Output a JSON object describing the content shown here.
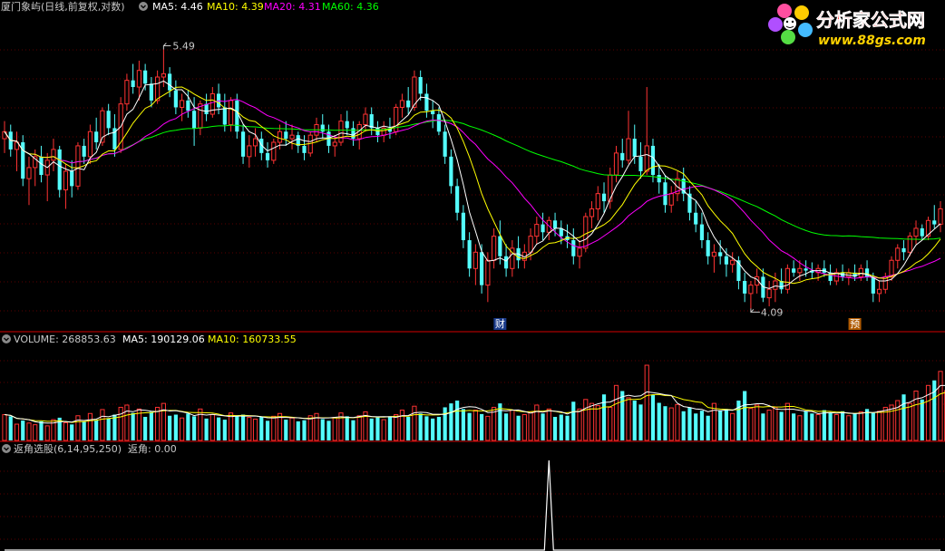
{
  "colors": {
    "background": "#000000",
    "divider": "#aa0000",
    "grid": "#5a0000",
    "up": "#ff3333",
    "down": "#54fcfc",
    "ma5": "#ffffff",
    "ma10": "#ffff00",
    "ma20": "#ff00ff",
    "ma60": "#00ff00",
    "text_gray": "#c8c8c8",
    "brand_red": "#ff2a2a",
    "brand_yellow": "#ffd200"
  },
  "main_panel": {
    "title": "厦门象屿(日线,前复权,对数)",
    "ma5_label": "MA5: 4.46",
    "ma10_label": "MA10: 4.39",
    "ma20_label": "MA20: 4.31",
    "ma60_label": "MA60: 4.36",
    "high_marker": "5.49",
    "low_marker": "4.09",
    "badge_1": "财",
    "badge_2": "预"
  },
  "volume_panel": {
    "volume_label": "VOLUME: 268853.63",
    "ma5_label": "MA5: 190129.06",
    "ma10_label": "MA10: 160733.55"
  },
  "indicator_panel": {
    "title": "返角选股(6,14,95,250)",
    "value_label": "返角: 0.00"
  },
  "logo": {
    "name": "分析家公式网",
    "url_text": "www.88gs.com",
    "icon": "flower-logo-icon"
  },
  "chart_data": {
    "type": "candlestick",
    "scale": "log",
    "price_range": [
      4.0,
      5.7
    ],
    "volume_range": [
      0,
      310000
    ],
    "indicator_range": [
      0,
      1
    ],
    "annotated_high": 5.49,
    "annotated_low": 4.09,
    "candles": [
      {
        "o": 4.96,
        "h": 5.06,
        "l": 4.88,
        "c": 5.0
      },
      {
        "o": 5.0,
        "h": 5.04,
        "l": 4.86,
        "c": 4.9
      },
      {
        "o": 4.9,
        "h": 5.0,
        "l": 4.78,
        "c": 4.94
      },
      {
        "o": 4.94,
        "h": 4.98,
        "l": 4.7,
        "c": 4.74
      },
      {
        "o": 4.74,
        "h": 4.86,
        "l": 4.6,
        "c": 4.8
      },
      {
        "o": 4.8,
        "h": 4.9,
        "l": 4.7,
        "c": 4.86
      },
      {
        "o": 4.86,
        "h": 4.92,
        "l": 4.72,
        "c": 4.76
      },
      {
        "o": 4.76,
        "h": 4.88,
        "l": 4.62,
        "c": 4.84
      },
      {
        "o": 4.84,
        "h": 4.96,
        "l": 4.78,
        "c": 4.9
      },
      {
        "o": 4.9,
        "h": 4.92,
        "l": 4.64,
        "c": 4.68
      },
      {
        "o": 4.68,
        "h": 4.82,
        "l": 4.58,
        "c": 4.78
      },
      {
        "o": 4.78,
        "h": 4.84,
        "l": 4.64,
        "c": 4.7
      },
      {
        "o": 4.7,
        "h": 4.94,
        "l": 4.68,
        "c": 4.92
      },
      {
        "o": 4.92,
        "h": 4.96,
        "l": 4.82,
        "c": 4.86
      },
      {
        "o": 4.86,
        "h": 5.04,
        "l": 4.82,
        "c": 5.0
      },
      {
        "o": 5.0,
        "h": 5.08,
        "l": 4.9,
        "c": 4.94
      },
      {
        "o": 4.94,
        "h": 5.14,
        "l": 4.92,
        "c": 5.12
      },
      {
        "o": 5.12,
        "h": 5.16,
        "l": 4.98,
        "c": 5.02
      },
      {
        "o": 5.02,
        "h": 5.1,
        "l": 4.86,
        "c": 4.9
      },
      {
        "o": 4.9,
        "h": 5.2,
        "l": 4.88,
        "c": 5.16
      },
      {
        "o": 5.16,
        "h": 5.34,
        "l": 5.12,
        "c": 5.3
      },
      {
        "o": 5.3,
        "h": 5.4,
        "l": 5.22,
        "c": 5.26
      },
      {
        "o": 5.26,
        "h": 5.42,
        "l": 5.18,
        "c": 5.36
      },
      {
        "o": 5.36,
        "h": 5.4,
        "l": 5.24,
        "c": 5.28
      },
      {
        "o": 5.28,
        "h": 5.32,
        "l": 5.14,
        "c": 5.18
      },
      {
        "o": 5.18,
        "h": 5.36,
        "l": 5.16,
        "c": 5.32
      },
      {
        "o": 5.32,
        "h": 5.49,
        "l": 5.26,
        "c": 5.34
      },
      {
        "o": 5.34,
        "h": 5.38,
        "l": 5.2,
        "c": 5.24
      },
      {
        "o": 5.24,
        "h": 5.3,
        "l": 5.1,
        "c": 5.14
      },
      {
        "o": 5.14,
        "h": 5.22,
        "l": 5.06,
        "c": 5.18
      },
      {
        "o": 5.18,
        "h": 5.24,
        "l": 5.08,
        "c": 5.12
      },
      {
        "o": 5.12,
        "h": 5.2,
        "l": 4.92,
        "c": 5.02
      },
      {
        "o": 5.02,
        "h": 5.18,
        "l": 4.98,
        "c": 5.16
      },
      {
        "o": 5.16,
        "h": 5.22,
        "l": 5.06,
        "c": 5.1
      },
      {
        "o": 5.1,
        "h": 5.26,
        "l": 5.08,
        "c": 5.22
      },
      {
        "o": 5.22,
        "h": 5.28,
        "l": 5.1,
        "c": 5.14
      },
      {
        "o": 5.14,
        "h": 5.22,
        "l": 5.0,
        "c": 5.04
      },
      {
        "o": 5.04,
        "h": 5.2,
        "l": 5.0,
        "c": 5.18
      },
      {
        "o": 5.18,
        "h": 5.22,
        "l": 4.96,
        "c": 5.0
      },
      {
        "o": 5.0,
        "h": 5.04,
        "l": 4.82,
        "c": 4.86
      },
      {
        "o": 4.86,
        "h": 4.98,
        "l": 4.8,
        "c": 4.92
      },
      {
        "o": 4.92,
        "h": 5.02,
        "l": 4.86,
        "c": 4.96
      },
      {
        "o": 4.96,
        "h": 5.0,
        "l": 4.84,
        "c": 4.88
      },
      {
        "o": 4.88,
        "h": 4.94,
        "l": 4.8,
        "c": 4.84
      },
      {
        "o": 4.84,
        "h": 4.96,
        "l": 4.82,
        "c": 4.94
      },
      {
        "o": 4.94,
        "h": 5.04,
        "l": 4.9,
        "c": 5.0
      },
      {
        "o": 5.0,
        "h": 5.06,
        "l": 4.92,
        "c": 4.96
      },
      {
        "o": 4.96,
        "h": 5.04,
        "l": 4.9,
        "c": 4.98
      },
      {
        "o": 4.98,
        "h": 5.0,
        "l": 4.88,
        "c": 4.92
      },
      {
        "o": 4.92,
        "h": 4.98,
        "l": 4.84,
        "c": 4.88
      },
      {
        "o": 4.88,
        "h": 5.0,
        "l": 4.86,
        "c": 4.98
      },
      {
        "o": 4.98,
        "h": 5.08,
        "l": 4.94,
        "c": 5.04
      },
      {
        "o": 5.04,
        "h": 5.1,
        "l": 4.96,
        "c": 5.0
      },
      {
        "o": 5.0,
        "h": 5.04,
        "l": 4.88,
        "c": 4.92
      },
      {
        "o": 4.92,
        "h": 4.98,
        "l": 4.86,
        "c": 4.94
      },
      {
        "o": 4.94,
        "h": 5.1,
        "l": 4.92,
        "c": 5.06
      },
      {
        "o": 5.06,
        "h": 5.12,
        "l": 4.98,
        "c": 5.02
      },
      {
        "o": 5.02,
        "h": 5.06,
        "l": 4.92,
        "c": 4.96
      },
      {
        "o": 4.96,
        "h": 5.06,
        "l": 4.9,
        "c": 5.04
      },
      {
        "o": 5.04,
        "h": 5.14,
        "l": 5.0,
        "c": 5.1
      },
      {
        "o": 5.1,
        "h": 5.14,
        "l": 4.98,
        "c": 5.02
      },
      {
        "o": 5.02,
        "h": 5.06,
        "l": 4.94,
        "c": 4.98
      },
      {
        "o": 4.98,
        "h": 5.06,
        "l": 4.94,
        "c": 5.02
      },
      {
        "o": 5.02,
        "h": 5.08,
        "l": 4.96,
        "c": 5.0
      },
      {
        "o": 5.0,
        "h": 5.16,
        "l": 4.98,
        "c": 5.14
      },
      {
        "o": 5.14,
        "h": 5.22,
        "l": 5.08,
        "c": 5.18
      },
      {
        "o": 5.18,
        "h": 5.26,
        "l": 5.1,
        "c": 5.14
      },
      {
        "o": 5.14,
        "h": 5.36,
        "l": 5.12,
        "c": 5.32
      },
      {
        "o": 5.32,
        "h": 5.36,
        "l": 5.18,
        "c": 5.22
      },
      {
        "o": 5.22,
        "h": 5.28,
        "l": 5.08,
        "c": 5.12
      },
      {
        "o": 5.12,
        "h": 5.18,
        "l": 5.02,
        "c": 5.1
      },
      {
        "o": 5.1,
        "h": 5.14,
        "l": 4.98,
        "c": 5.0
      },
      {
        "o": 5.0,
        "h": 5.04,
        "l": 4.82,
        "c": 4.86
      },
      {
        "o": 4.86,
        "h": 4.9,
        "l": 4.66,
        "c": 4.7
      },
      {
        "o": 4.7,
        "h": 4.74,
        "l": 4.52,
        "c": 4.56
      },
      {
        "o": 4.56,
        "h": 4.6,
        "l": 4.38,
        "c": 4.42
      },
      {
        "o": 4.42,
        "h": 4.46,
        "l": 4.24,
        "c": 4.28
      },
      {
        "o": 4.28,
        "h": 4.4,
        "l": 4.2,
        "c": 4.36
      },
      {
        "o": 4.36,
        "h": 4.4,
        "l": 4.16,
        "c": 4.2
      },
      {
        "o": 4.2,
        "h": 4.36,
        "l": 4.12,
        "c": 4.32
      },
      {
        "o": 4.32,
        "h": 4.48,
        "l": 4.28,
        "c": 4.44
      },
      {
        "o": 4.44,
        "h": 4.52,
        "l": 4.3,
        "c": 4.34
      },
      {
        "o": 4.34,
        "h": 4.4,
        "l": 4.24,
        "c": 4.28
      },
      {
        "o": 4.28,
        "h": 4.42,
        "l": 4.24,
        "c": 4.38
      },
      {
        "o": 4.38,
        "h": 4.44,
        "l": 4.28,
        "c": 4.32
      },
      {
        "o": 4.32,
        "h": 4.4,
        "l": 4.28,
        "c": 4.36
      },
      {
        "o": 4.36,
        "h": 4.48,
        "l": 4.32,
        "c": 4.44
      },
      {
        "o": 4.44,
        "h": 4.54,
        "l": 4.4,
        "c": 4.5
      },
      {
        "o": 4.5,
        "h": 4.56,
        "l": 4.42,
        "c": 4.46
      },
      {
        "o": 4.46,
        "h": 4.54,
        "l": 4.42,
        "c": 4.52
      },
      {
        "o": 4.52,
        "h": 4.56,
        "l": 4.44,
        "c": 4.48
      },
      {
        "o": 4.48,
        "h": 4.52,
        "l": 4.4,
        "c": 4.44
      },
      {
        "o": 4.44,
        "h": 4.5,
        "l": 4.38,
        "c": 4.42
      },
      {
        "o": 4.42,
        "h": 4.48,
        "l": 4.3,
        "c": 4.34
      },
      {
        "o": 4.34,
        "h": 4.42,
        "l": 4.28,
        "c": 4.38
      },
      {
        "o": 4.38,
        "h": 4.56,
        "l": 4.36,
        "c": 4.54
      },
      {
        "o": 4.54,
        "h": 4.62,
        "l": 4.48,
        "c": 4.58
      },
      {
        "o": 4.58,
        "h": 4.7,
        "l": 4.52,
        "c": 4.66
      },
      {
        "o": 4.66,
        "h": 4.72,
        "l": 4.56,
        "c": 4.62
      },
      {
        "o": 4.62,
        "h": 4.8,
        "l": 4.58,
        "c": 4.76
      },
      {
        "o": 4.76,
        "h": 4.92,
        "l": 4.72,
        "c": 4.88
      },
      {
        "o": 4.88,
        "h": 4.96,
        "l": 4.8,
        "c": 4.84
      },
      {
        "o": 4.84,
        "h": 5.12,
        "l": 4.82,
        "c": 4.96
      },
      {
        "o": 4.96,
        "h": 5.04,
        "l": 4.82,
        "c": 4.86
      },
      {
        "o": 4.86,
        "h": 4.94,
        "l": 4.74,
        "c": 4.78
      },
      {
        "o": 4.78,
        "h": 5.26,
        "l": 4.76,
        "c": 4.92
      },
      {
        "o": 4.92,
        "h": 4.96,
        "l": 4.72,
        "c": 4.76
      },
      {
        "o": 4.76,
        "h": 4.82,
        "l": 4.66,
        "c": 4.72
      },
      {
        "o": 4.72,
        "h": 4.76,
        "l": 4.56,
        "c": 4.6
      },
      {
        "o": 4.6,
        "h": 4.7,
        "l": 4.56,
        "c": 4.66
      },
      {
        "o": 4.66,
        "h": 4.78,
        "l": 4.62,
        "c": 4.74
      },
      {
        "o": 4.74,
        "h": 4.8,
        "l": 4.62,
        "c": 4.66
      },
      {
        "o": 4.66,
        "h": 4.7,
        "l": 4.52,
        "c": 4.56
      },
      {
        "o": 4.56,
        "h": 4.62,
        "l": 4.46,
        "c": 4.5
      },
      {
        "o": 4.5,
        "h": 4.56,
        "l": 4.38,
        "c": 4.42
      },
      {
        "o": 4.42,
        "h": 4.46,
        "l": 4.3,
        "c": 4.34
      },
      {
        "o": 4.34,
        "h": 4.4,
        "l": 4.26,
        "c": 4.36
      },
      {
        "o": 4.36,
        "h": 4.42,
        "l": 4.3,
        "c": 4.34
      },
      {
        "o": 4.34,
        "h": 4.38,
        "l": 4.24,
        "c": 4.3
      },
      {
        "o": 4.3,
        "h": 4.36,
        "l": 4.26,
        "c": 4.32
      },
      {
        "o": 4.32,
        "h": 4.34,
        "l": 4.18,
        "c": 4.22
      },
      {
        "o": 4.22,
        "h": 4.26,
        "l": 4.12,
        "c": 4.16
      },
      {
        "o": 4.16,
        "h": 4.22,
        "l": 4.09,
        "c": 4.2
      },
      {
        "o": 4.2,
        "h": 4.28,
        "l": 4.16,
        "c": 4.24
      },
      {
        "o": 4.24,
        "h": 4.28,
        "l": 4.12,
        "c": 4.14
      },
      {
        "o": 4.14,
        "h": 4.22,
        "l": 4.1,
        "c": 4.18
      },
      {
        "o": 4.18,
        "h": 4.26,
        "l": 4.12,
        "c": 4.22
      },
      {
        "o": 4.22,
        "h": 4.28,
        "l": 4.16,
        "c": 4.18
      },
      {
        "o": 4.18,
        "h": 4.3,
        "l": 4.16,
        "c": 4.28
      },
      {
        "o": 4.28,
        "h": 4.32,
        "l": 4.24,
        "c": 4.26
      },
      {
        "o": 4.26,
        "h": 4.32,
        "l": 4.22,
        "c": 4.28
      },
      {
        "o": 4.28,
        "h": 4.32,
        "l": 4.24,
        "c": 4.27
      },
      {
        "o": 4.27,
        "h": 4.31,
        "l": 4.23,
        "c": 4.26
      },
      {
        "o": 4.26,
        "h": 4.3,
        "l": 4.22,
        "c": 4.28
      },
      {
        "o": 4.28,
        "h": 4.32,
        "l": 4.24,
        "c": 4.26
      },
      {
        "o": 4.26,
        "h": 4.3,
        "l": 4.2,
        "c": 4.22
      },
      {
        "o": 4.22,
        "h": 4.28,
        "l": 4.2,
        "c": 4.26
      },
      {
        "o": 4.26,
        "h": 4.3,
        "l": 4.22,
        "c": 4.24
      },
      {
        "o": 4.24,
        "h": 4.28,
        "l": 4.2,
        "c": 4.26
      },
      {
        "o": 4.26,
        "h": 4.3,
        "l": 4.22,
        "c": 4.24
      },
      {
        "o": 4.24,
        "h": 4.3,
        "l": 4.22,
        "c": 4.28
      },
      {
        "o": 4.28,
        "h": 4.32,
        "l": 4.22,
        "c": 4.24
      },
      {
        "o": 4.24,
        "h": 4.26,
        "l": 4.12,
        "c": 4.16
      },
      {
        "o": 4.16,
        "h": 4.22,
        "l": 4.12,
        "c": 4.18
      },
      {
        "o": 4.18,
        "h": 4.26,
        "l": 4.16,
        "c": 4.24
      },
      {
        "o": 4.24,
        "h": 4.34,
        "l": 4.22,
        "c": 4.32
      },
      {
        "o": 4.32,
        "h": 4.4,
        "l": 4.28,
        "c": 4.38
      },
      {
        "o": 4.38,
        "h": 4.42,
        "l": 4.32,
        "c": 4.36
      },
      {
        "o": 4.36,
        "h": 4.46,
        "l": 4.34,
        "c": 4.44
      },
      {
        "o": 4.44,
        "h": 4.52,
        "l": 4.4,
        "c": 4.48
      },
      {
        "o": 4.48,
        "h": 4.5,
        "l": 4.42,
        "c": 4.44
      },
      {
        "o": 4.44,
        "h": 4.54,
        "l": 4.42,
        "c": 4.52
      },
      {
        "o": 4.52,
        "h": 4.6,
        "l": 4.48,
        "c": 4.5
      },
      {
        "o": 4.5,
        "h": 4.62,
        "l": 4.46,
        "c": 4.58
      }
    ],
    "volume": [
      92000,
      86000,
      58000,
      71000,
      62000,
      56000,
      68000,
      52000,
      74000,
      81000,
      63000,
      57000,
      88000,
      66000,
      96000,
      72000,
      110000,
      78000,
      92000,
      118000,
      126000,
      98000,
      112000,
      84000,
      102000,
      118000,
      132000,
      88000,
      92000,
      80000,
      96000,
      86000,
      112000,
      78000,
      92000,
      82000,
      74000,
      98000,
      88000,
      92000,
      82000,
      76000,
      84000,
      70000,
      86000,
      96000,
      74000,
      80000,
      68000,
      72000,
      88000,
      96000,
      76000,
      70000,
      82000,
      98000,
      86000,
      72000,
      88000,
      102000,
      78000,
      82000,
      74000,
      86000,
      92000,
      108000,
      84000,
      122000,
      96000,
      86000,
      78000,
      84000,
      118000,
      132000,
      142000,
      112000,
      98000,
      108000,
      94000,
      86000,
      118000,
      132000,
      96000,
      108000,
      88000,
      92000,
      102000,
      126000,
      96000,
      112000,
      84000,
      92000,
      88000,
      138000,
      112000,
      146000,
      132000,
      124000,
      164000,
      118000,
      196000,
      176000,
      152000,
      142000,
      128000,
      268000,
      162000,
      134000,
      122000,
      116000,
      128000,
      104000,
      118000,
      96000,
      106000,
      88000,
      132000,
      108000,
      112000,
      96000,
      142000,
      176000,
      114000,
      126000,
      96000,
      108000,
      118000,
      102000,
      132000,
      96000,
      88000,
      104000,
      96000,
      92000,
      108000,
      98000,
      92000,
      104000,
      88000,
      96000,
      102000,
      112000,
      98000,
      104000,
      118000,
      126000,
      142000,
      164000,
      132000,
      176000,
      146000,
      196000,
      214000,
      246000,
      178000,
      268853
    ],
    "indicator": {
      "series": "返角",
      "spike_index": 89,
      "spike_value": 1.0
    }
  }
}
